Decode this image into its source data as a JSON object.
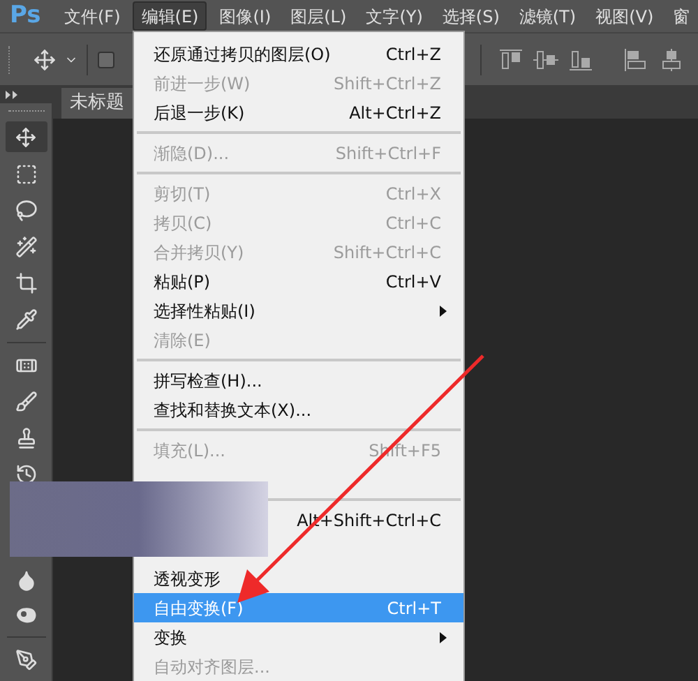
{
  "app": {
    "logo": "Ps"
  },
  "menubar": [
    {
      "label": "文件(F)",
      "selected": false
    },
    {
      "label": "编辑(E)",
      "selected": true
    },
    {
      "label": "图像(I)",
      "selected": false
    },
    {
      "label": "图层(L)",
      "selected": false
    },
    {
      "label": "文字(Y)",
      "selected": false
    },
    {
      "label": "选择(S)",
      "selected": false
    },
    {
      "label": "滤镜(T)",
      "selected": false
    },
    {
      "label": "视图(V)",
      "selected": false
    },
    {
      "label": "窗",
      "selected": false
    }
  ],
  "document_tab": {
    "title": "未标题"
  },
  "options": {
    "checked": false
  },
  "edit_menu": [
    {
      "kind": "item",
      "label": "还原通过拷贝的图层(O)",
      "shortcut": "Ctrl+Z",
      "disabled": false,
      "selected": false
    },
    {
      "kind": "item",
      "label": "前进一步(W)",
      "shortcut": "Shift+Ctrl+Z",
      "disabled": true,
      "selected": false
    },
    {
      "kind": "item",
      "label": "后退一步(K)",
      "shortcut": "Alt+Ctrl+Z",
      "disabled": false,
      "selected": false
    },
    {
      "kind": "separator"
    },
    {
      "kind": "item",
      "label": "渐隐(D)...",
      "shortcut": "Shift+Ctrl+F",
      "disabled": true,
      "selected": false
    },
    {
      "kind": "separator"
    },
    {
      "kind": "item",
      "label": "剪切(T)",
      "shortcut": "Ctrl+X",
      "disabled": true,
      "selected": false
    },
    {
      "kind": "item",
      "label": "拷贝(C)",
      "shortcut": "Ctrl+C",
      "disabled": true,
      "selected": false
    },
    {
      "kind": "item",
      "label": "合并拷贝(Y)",
      "shortcut": "Shift+Ctrl+C",
      "disabled": true,
      "selected": false
    },
    {
      "kind": "item",
      "label": "粘贴(P)",
      "shortcut": "Ctrl+V",
      "disabled": false,
      "selected": false
    },
    {
      "kind": "submenu",
      "label": "选择性粘贴(I)",
      "disabled": false,
      "selected": false
    },
    {
      "kind": "item",
      "label": "清除(E)",
      "disabled": true,
      "selected": false
    },
    {
      "kind": "separator"
    },
    {
      "kind": "item",
      "label": "拼写检查(H)...",
      "disabled": false,
      "selected": false
    },
    {
      "kind": "item",
      "label": "查找和替换文本(X)...",
      "disabled": false,
      "selected": false
    },
    {
      "kind": "separator"
    },
    {
      "kind": "item",
      "label": "填充(L)...",
      "shortcut": "Shift+F5",
      "disabled": true,
      "selected": false
    },
    {
      "kind": "covered"
    },
    {
      "kind": "separator"
    },
    {
      "kind": "covered",
      "shortcut": "Alt+Shift+Ctrl+C"
    },
    {
      "kind": "covered"
    },
    {
      "kind": "item",
      "label": "透视变形",
      "disabled": false,
      "selected": false
    },
    {
      "kind": "item",
      "label": "自由变换(F)",
      "shortcut": "Ctrl+T",
      "disabled": false,
      "selected": true
    },
    {
      "kind": "submenu",
      "label": "变换",
      "disabled": false,
      "selected": false
    },
    {
      "kind": "item",
      "label": "自动对齐图层...",
      "disabled": true,
      "selected": false
    }
  ]
}
